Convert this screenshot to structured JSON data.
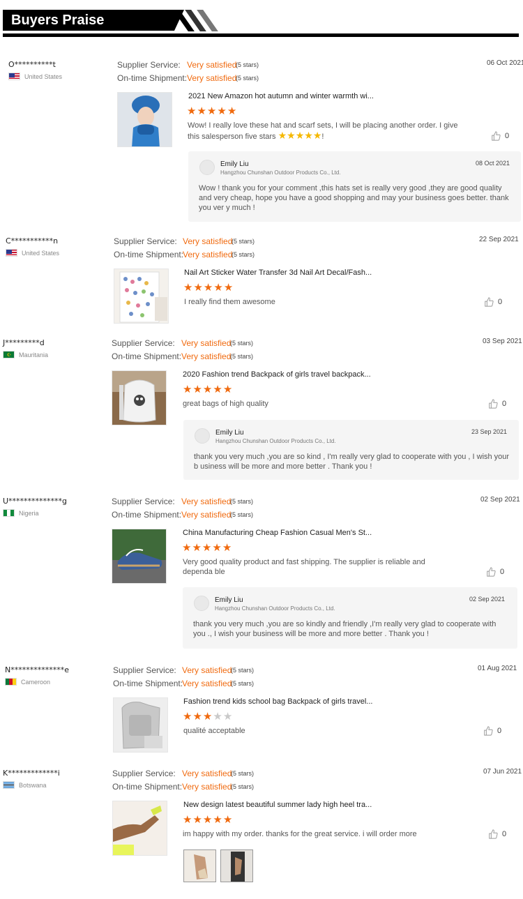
{
  "header": {
    "title": "Buyers Praise"
  },
  "labels": {
    "supplier": "Supplier Service:",
    "ontime": "On-time Shipment:"
  },
  "colors": {
    "accent": "#f06a0f",
    "star_off": "#c9c9c9"
  },
  "reviews": [
    {
      "user": "O**********t",
      "country": "United States",
      "flag": "us",
      "supplier": "Very satisfied",
      "supplier_stars": "(5 stars)",
      "ontime": "Very satisfied",
      "ontime_stars": "(5 stars)",
      "date": "06 Oct 2021",
      "product": "2021 New Amazon hot autumn and winter warmth wi...",
      "rating": 5,
      "comment_a": "Wow! I really love these hat and scarf sets, I will be placing another order. I give",
      "comment_b": "this salesperson five stars",
      "comment_c": "!",
      "likes": "0",
      "reply": {
        "name": "Emily Liu",
        "company": "Hangzhou Chunshan Outdoor Products Co., Ltd.",
        "date": "08 Oct 2021",
        "text": "Wow ! thank you for your comment ,this hats set is really very good ,they are good quality and very cheap, hope you have a good shopping and may your business goes better. thank you ver y much !"
      }
    },
    {
      "user": "C***********n",
      "country": "United States",
      "flag": "us",
      "supplier": "Very satisfied",
      "supplier_stars": "(5 stars)",
      "ontime": "Very satisfied",
      "ontime_stars": "(5 stars)",
      "date": "22 Sep 2021",
      "product": "Nail Art Sticker Water Transfer 3d Nail Art Decal/Fash...",
      "rating": 5,
      "comment": "I really find them awesome",
      "likes": "0"
    },
    {
      "user": "J*********d",
      "country": "Mauritania",
      "flag": "mr",
      "supplier": "Very satisfied",
      "supplier_stars": "(5 stars)",
      "ontime": "Very satisfied",
      "ontime_stars": "(5 stars)",
      "date": "03 Sep 2021",
      "product": "2020 Fashion trend Backpack of girls travel backpack...",
      "rating": 5,
      "comment": "great bags of high quality",
      "likes": "0",
      "reply": {
        "name": "Emily Liu",
        "company": "Hangzhou Chunshan Outdoor Products Co., Ltd.",
        "date": "23 Sep 2021",
        "text": "thank you very much ,you are so kind  , I'm really very glad to cooperate with you , I wish your b usiness will be more and more better . Thank you !"
      }
    },
    {
      "user": "U**************g",
      "country": "Nigeria",
      "flag": "ng",
      "supplier": "Very satisfied",
      "supplier_stars": "(5 stars)",
      "ontime": "Very satisfied",
      "ontime_stars": "(5 stars)",
      "date": "02 Sep 2021",
      "product": "China Manufacturing Cheap Fashion Casual Men's St...",
      "rating": 5,
      "comment": "Very good quality product and fast shipping. The supplier is reliable and dependa ble",
      "likes": "0",
      "reply": {
        "name": "Emily Liu",
        "company": "Hangzhou Chunshan Outdoor Products Co., Ltd.",
        "date": "02 Sep 2021",
        "text": "thank you very much ,you are so kindly and friendly ,I'm really very glad to cooperate with you ., I wish your business will be more and more better . Thank you !"
      }
    },
    {
      "user": "N**************e",
      "country": "Cameroon",
      "flag": "cm",
      "supplier": "Very satisfied",
      "supplier_stars": "(5 stars)",
      "ontime": "Very satisfied",
      "ontime_stars": "(5 stars)",
      "date": "01 Aug 2021",
      "product": "Fashion trend kids school bag Backpack of girls travel...",
      "rating": 3,
      "comment": "qualité acceptable",
      "likes": "0"
    },
    {
      "user": "K*************i",
      "country": "Botswana",
      "flag": "bw",
      "supplier": "Very satisfied",
      "supplier_stars": "(5 stars)",
      "ontime": "Very satisfied",
      "ontime_stars": "(5 stars)",
      "date": "07 Jun 2021",
      "product": "New design latest beautiful summer lady high heel tra...",
      "rating": 5,
      "comment": "im happy with my order. thanks for the great service. i will order more",
      "likes": "0"
    }
  ]
}
